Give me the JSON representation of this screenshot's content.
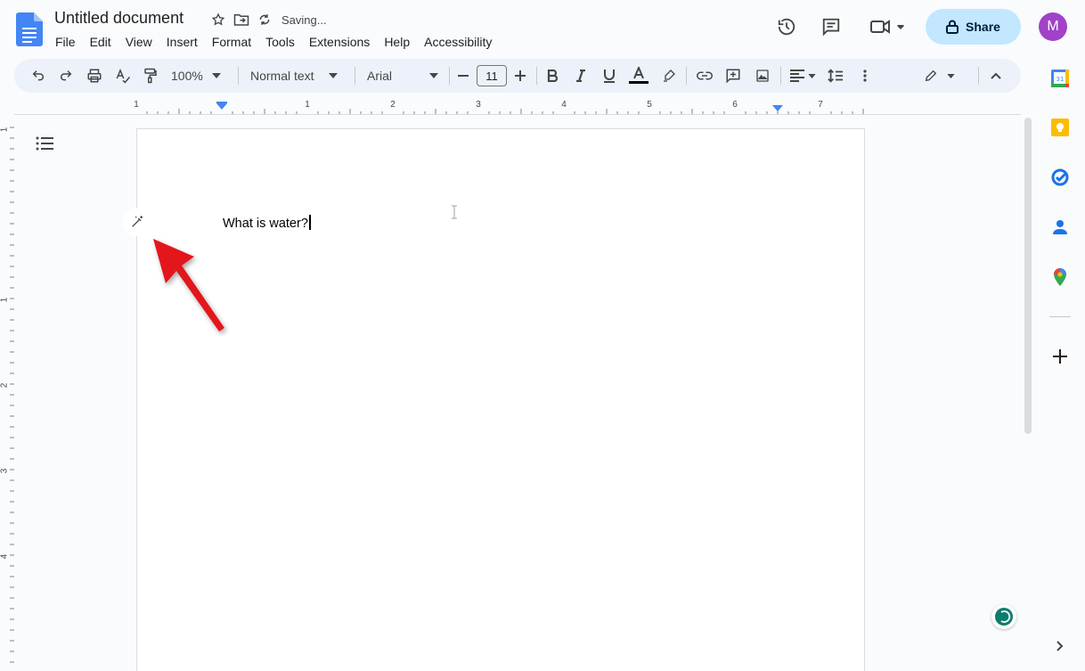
{
  "document": {
    "title": "Untitled document",
    "saving_status": "Saving...",
    "body_text": "What is water?"
  },
  "menu": [
    "File",
    "Edit",
    "View",
    "Insert",
    "Format",
    "Tools",
    "Extensions",
    "Help",
    "Accessibility"
  ],
  "header": {
    "share_label": "Share",
    "avatar_initial": "M",
    "avatar_color": "#a142c9",
    "share_color": "#c2e7ff"
  },
  "toolbar": {
    "zoom": "100%",
    "style": "Normal text",
    "font": "Arial",
    "font_size": "11"
  },
  "ruler": {
    "numbers": [
      "1",
      "1",
      "2",
      "3",
      "4",
      "5",
      "6",
      "7"
    ]
  },
  "vruler": {
    "numbers": [
      "1",
      "1",
      "2",
      "3",
      "4"
    ]
  },
  "icons": {
    "side_panel": [
      "calendar-icon",
      "keep-icon",
      "tasks-icon",
      "contacts-icon",
      "maps-icon",
      "add-icon"
    ]
  }
}
